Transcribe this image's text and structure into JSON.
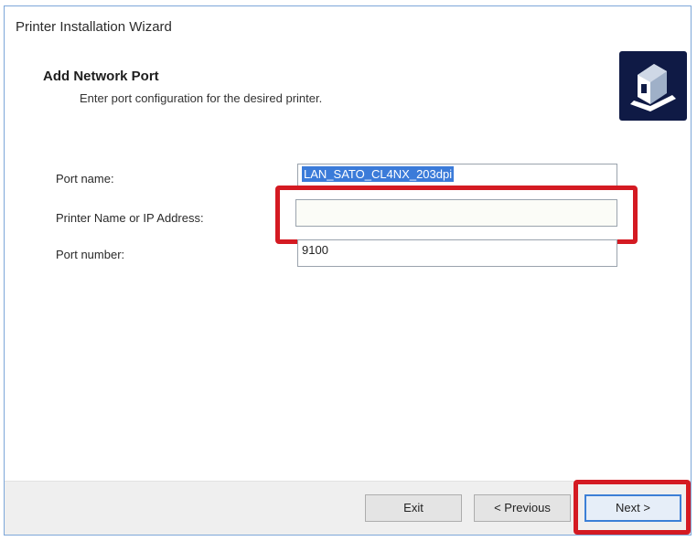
{
  "window": {
    "title": "Printer Installation Wizard"
  },
  "header": {
    "heading": "Add Network Port",
    "subheading": "Enter port configuration for the desired printer."
  },
  "form": {
    "port_name": {
      "label": "Port name:",
      "value": "LAN_SATO_CL4NX_203dpi"
    },
    "printer_name": {
      "label": "Printer Name or IP Address:",
      "value": ""
    },
    "port_number": {
      "label": "Port number:",
      "value": "9100"
    }
  },
  "buttons": {
    "exit": "Exit",
    "previous": "< Previous",
    "next": "Next >"
  },
  "colors": {
    "highlight": "#d41a22",
    "selection": "#3b7bd9",
    "logo_bg": "#0f1a45"
  },
  "icons": {
    "logo": "printer-icon"
  }
}
